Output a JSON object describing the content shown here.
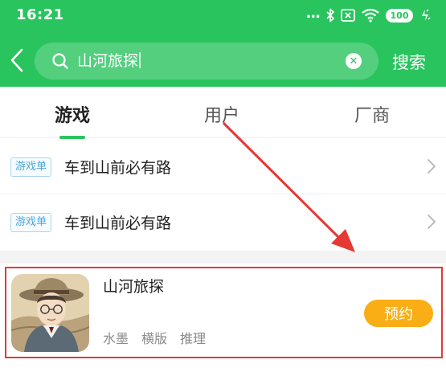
{
  "status_bar": {
    "time": "16:21",
    "dots": "...",
    "battery": "100"
  },
  "search": {
    "query": "山河旅探",
    "button_label": "搜索"
  },
  "tabs": [
    {
      "label": "游戏",
      "active": true
    },
    {
      "label": "用户",
      "active": false
    },
    {
      "label": "厂商",
      "active": false
    }
  ],
  "game_lists": [
    {
      "tag": "游戏单",
      "title": "车到山前必有路"
    },
    {
      "tag": "游戏单",
      "title": "车到山前必有路"
    }
  ],
  "game_card": {
    "name": "山河旅探",
    "tags": [
      "水墨",
      "横版",
      "推理"
    ],
    "action_label": "预约"
  },
  "colors": {
    "brand_green": "#29c45e",
    "reserve_orange": "#f8ae14",
    "highlight_red": "#e03a3a",
    "tag_blue": "#4ea7da"
  },
  "icons": [
    "back-icon",
    "search-icon",
    "clear-icon",
    "bluetooth-icon",
    "sim-icon",
    "wifi-icon",
    "battery-icon",
    "charging-icon",
    "chevron-right-icon"
  ]
}
